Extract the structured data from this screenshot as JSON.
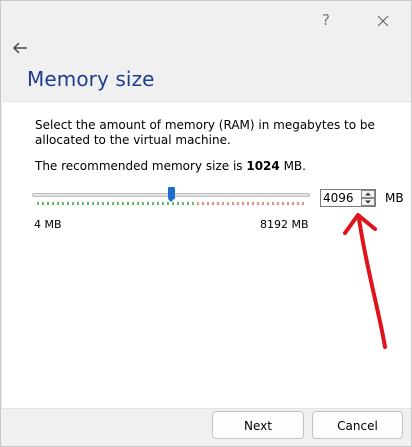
{
  "dialog": {
    "title": "Memory size",
    "description": "Select the amount of memory (RAM) in megabytes to be allocated to the virtual machine.",
    "recommended_prefix": "The recommended memory size is ",
    "recommended_value": "1024",
    "recommended_suffix": " MB.",
    "help_glyph": "?"
  },
  "memory": {
    "value": "4096",
    "min_label": "4 MB",
    "max_label": "8192 MB",
    "unit": "MB",
    "min": 4,
    "max": 8192,
    "selected": 4096,
    "recommended": 1024
  },
  "buttons": {
    "next": "Next",
    "cancel": "Cancel"
  },
  "icons": [
    "back-arrow-icon",
    "help-icon",
    "close-icon",
    "spin-up-icon",
    "spin-down-icon",
    "annotation-arrow"
  ],
  "colors": {
    "title": "#1f3d8f",
    "slider_thumb": "#1a6fd1",
    "annotation": "#e0121b"
  }
}
